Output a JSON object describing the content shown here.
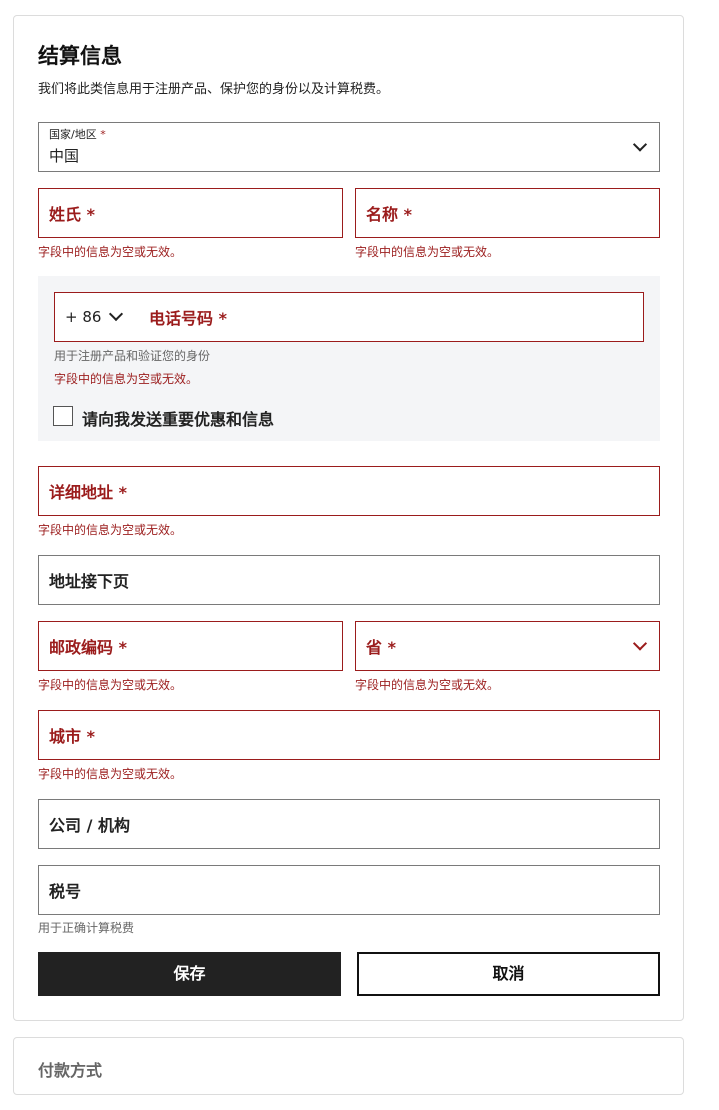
{
  "billing": {
    "title": "结算信息",
    "subtitle": "我们将此类信息用于注册产品、保护您的身份以及计算税费。",
    "country": {
      "label": "国家/地区",
      "required_mark": "*",
      "value": "中国"
    },
    "last_name": {
      "label": "姓氏 *",
      "error": "字段中的信息为空或无效。"
    },
    "first_name": {
      "label": "名称 *",
      "error": "字段中的信息为空或无效。"
    },
    "phone": {
      "country_code": "+ 86",
      "label": "电话号码 *",
      "hint": "用于注册产品和验证您的身份",
      "error": "字段中的信息为空或无效。"
    },
    "marketing_checkbox": {
      "label": "请向我发送重要优惠和信息",
      "checked": false
    },
    "address": {
      "label": "详细地址 *",
      "error": "字段中的信息为空或无效。"
    },
    "address2": {
      "label": "地址接下页"
    },
    "postal": {
      "label": "邮政编码 *",
      "error": "字段中的信息为空或无效。"
    },
    "province": {
      "label": "省 *",
      "error": "字段中的信息为空或无效。"
    },
    "city": {
      "label": "城市 *",
      "error": "字段中的信息为空或无效。"
    },
    "company": {
      "label": "公司 / 机构"
    },
    "tax_id": {
      "label": "税号",
      "hint": "用于正确计算税费"
    },
    "save_label": "保存",
    "cancel_label": "取消"
  },
  "payment": {
    "title": "付款方式"
  },
  "colors": {
    "error": "#9b1c1c",
    "primary_button": "#222222",
    "panel_bg": "#f4f5f7"
  },
  "icons": {
    "dropdown": "chevron-down-icon"
  }
}
